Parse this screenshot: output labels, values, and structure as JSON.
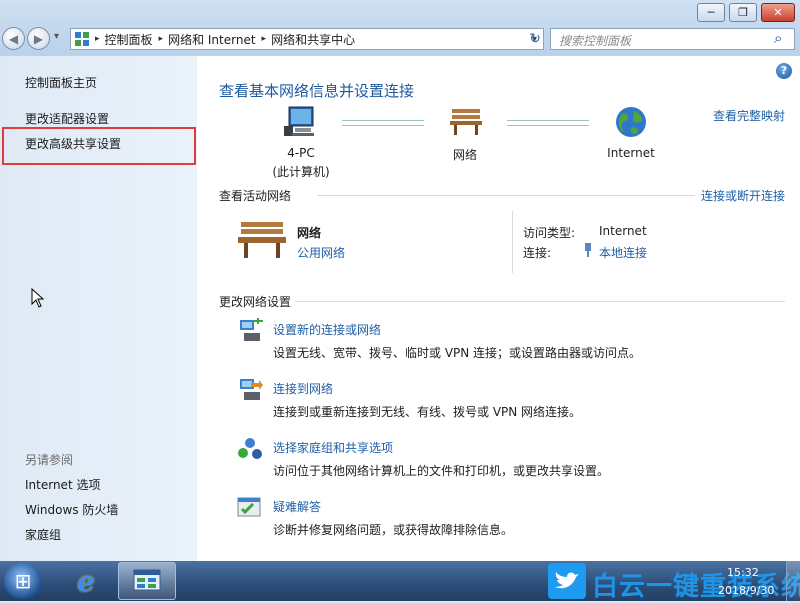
{
  "window": {
    "minimize_glyph": "─",
    "maximize_glyph": "❐",
    "close_glyph": "✕"
  },
  "navigation": {
    "back_glyph": "◀",
    "forward_glyph": "▶",
    "dropdown_glyph": "▾",
    "breadcrumb": [
      "控制面板",
      "网络和 Internet",
      "网络和共享中心"
    ],
    "breadcrumb_separator": "▸",
    "refresh_glyph": "↻",
    "search_placeholder": "搜索控制面板",
    "search_glyph": "⌕"
  },
  "left_pane": {
    "home": "控制面板主页",
    "links": [
      "更改适配器设置",
      "更改高级共享设置"
    ],
    "see_also_title": "另请参阅",
    "see_also": [
      "Internet 选项",
      "Windows 防火墙",
      "家庭组"
    ]
  },
  "main": {
    "help_glyph": "?",
    "heading": "查看基本网络信息并设置连接",
    "view_full_map": "查看完整映射",
    "map_nodes": [
      {
        "label": "4-PC",
        "sublabel": "(此计算机)",
        "icon": "computer-icon"
      },
      {
        "label": "网络",
        "sublabel": "",
        "icon": "bench-icon"
      },
      {
        "label": "Internet",
        "sublabel": "",
        "icon": "globe-icon"
      }
    ],
    "active_networks_title": "查看活动网络",
    "connect_disconnect": "连接或断开连接",
    "network_name": "网络",
    "network_type": "公用网络",
    "access_type_label": "访问类型:",
    "access_type_value": "Internet",
    "connections_label": "连接:",
    "connection_value": "本地连接",
    "change_settings_title": "更改网络设置",
    "tasks": [
      {
        "title": "设置新的连接或网络",
        "desc": "设置无线、宽带、拨号、临时或 VPN 连接；或设置路由器或访问点。",
        "icon": "new-connection-icon"
      },
      {
        "title": "连接到网络",
        "desc": "连接到或重新连接到无线、有线、拨号或 VPN 网络连接。",
        "icon": "connect-network-icon"
      },
      {
        "title": "选择家庭组和共享选项",
        "desc": "访问位于其他网络计算机上的文件和打印机，或更改共享设置。",
        "icon": "homegroup-icon"
      },
      {
        "title": "疑难解答",
        "desc": "诊断并修复网络问题，或获得故障排除信息。",
        "icon": "troubleshoot-icon"
      }
    ]
  },
  "taskbar": {
    "start_glyph": "⊞",
    "ie_glyph": "e",
    "watermark": "白云一键重装系统",
    "time": "15:32",
    "date": "2018/9/30"
  },
  "colors": {
    "link": "#1f5fa7",
    "heading": "#1e5aa0",
    "highlight_box": "#e03c3c"
  }
}
